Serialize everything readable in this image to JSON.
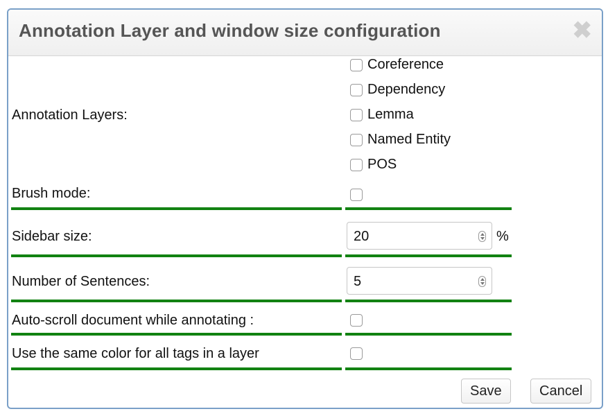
{
  "dialog": {
    "title": "Annotation Layer and window size configuration",
    "close_glyph": "✖"
  },
  "annotation_layers": {
    "label": "Annotation Layers:",
    "options": [
      {
        "label": "Coreference",
        "checked": false
      },
      {
        "label": "Dependency",
        "checked": false
      },
      {
        "label": "Lemma",
        "checked": false
      },
      {
        "label": "Named Entity",
        "checked": false
      },
      {
        "label": "POS",
        "checked": false
      }
    ]
  },
  "brush_mode": {
    "label": "Brush mode:",
    "checked": false
  },
  "sidebar_size": {
    "label": "Sidebar size:",
    "value": "20",
    "unit": "%"
  },
  "sentences": {
    "label": "Number of Sentences:",
    "value": "5"
  },
  "auto_scroll": {
    "label": "Auto-scroll document while annotating :",
    "checked": false
  },
  "same_color": {
    "label": "Use the same color for all tags in a layer",
    "checked": false
  },
  "buttons": {
    "save": "Save",
    "cancel": "Cancel"
  },
  "colors": {
    "separator": "#128212",
    "dialog_border": "#7aa0c8"
  }
}
